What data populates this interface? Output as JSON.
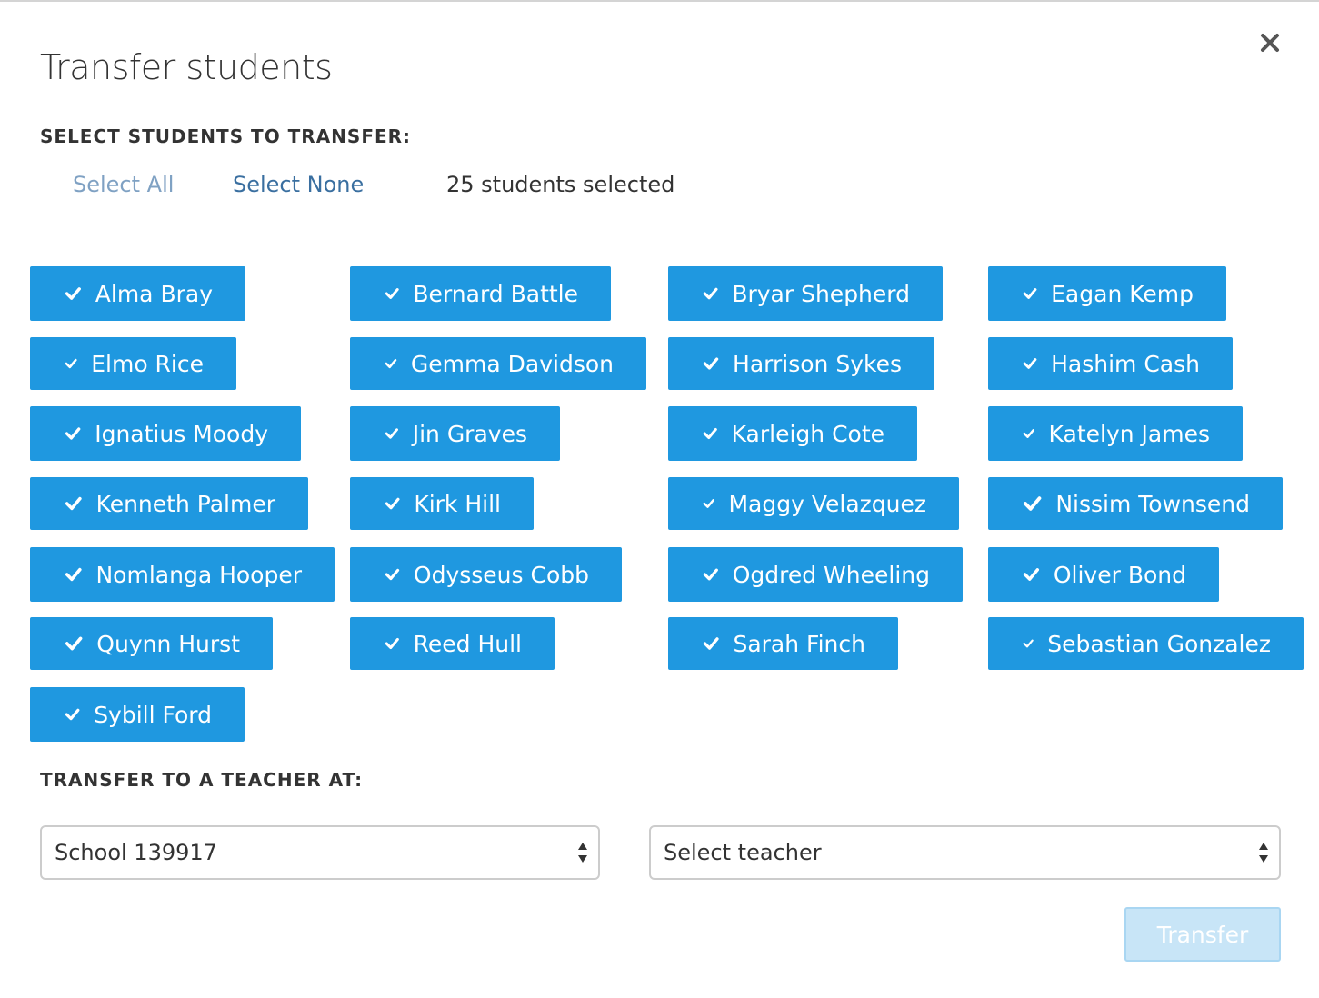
{
  "modal": {
    "title": "Transfer students",
    "close_icon": "close-icon"
  },
  "students_section": {
    "label": "SELECT STUDENTS TO TRANSFER:",
    "select_all": "Select All",
    "select_none": "Select None",
    "selected_count": "25 students selected"
  },
  "students": [
    {
      "name": "Alma Bray",
      "checked": true
    },
    {
      "name": "Bernard Battle",
      "checked": true
    },
    {
      "name": "Bryar Shepherd",
      "checked": true
    },
    {
      "name": "Eagan Kemp",
      "checked": true
    },
    {
      "name": "Elmo Rice",
      "checked": true
    },
    {
      "name": "Gemma Davidson",
      "checked": true
    },
    {
      "name": "Harrison Sykes",
      "checked": true
    },
    {
      "name": "Hashim Cash",
      "checked": true
    },
    {
      "name": "Ignatius Moody",
      "checked": true
    },
    {
      "name": "Jin Graves",
      "checked": true
    },
    {
      "name": "Karleigh Cote",
      "checked": true
    },
    {
      "name": "Katelyn James",
      "checked": true
    },
    {
      "name": "Kenneth Palmer",
      "checked": true
    },
    {
      "name": "Kirk Hill",
      "checked": true
    },
    {
      "name": "Maggy Velazquez",
      "checked": true
    },
    {
      "name": "Nissim Townsend",
      "checked": true
    },
    {
      "name": "Nomlanga Hooper",
      "checked": true
    },
    {
      "name": "Odysseus Cobb",
      "checked": true
    },
    {
      "name": "Ogdred Wheeling",
      "checked": true
    },
    {
      "name": "Oliver Bond",
      "checked": true
    },
    {
      "name": "Quynn Hurst",
      "checked": true
    },
    {
      "name": "Reed Hull",
      "checked": true
    },
    {
      "name": "Sarah Finch",
      "checked": true
    },
    {
      "name": "Sebastian Gonzalez",
      "checked": true
    },
    {
      "name": "Sybill Ford",
      "checked": true
    }
  ],
  "transfer_section": {
    "label": "TRANSFER TO A TEACHER AT:",
    "school_select": {
      "value": "School 139917"
    },
    "teacher_select": {
      "value": "Select teacher"
    },
    "transfer_button": "Transfer",
    "transfer_enabled": false
  },
  "colors": {
    "accent": "#1f98e0",
    "disabled_button": "#c8e5f7",
    "link": "#3a6fa0",
    "link_muted": "#7fa1c3"
  }
}
